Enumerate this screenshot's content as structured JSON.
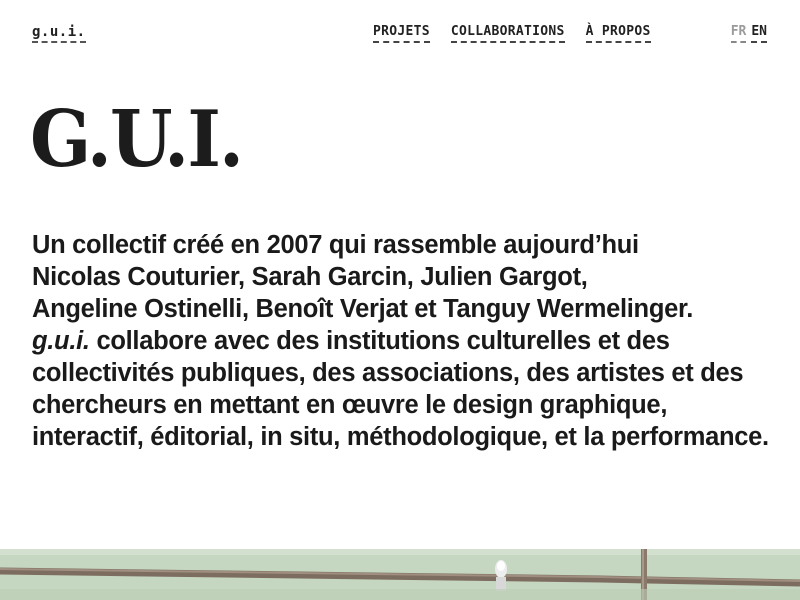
{
  "header": {
    "logo": "g.u.i.",
    "nav": [
      {
        "label": "PROJETS"
      },
      {
        "label": "COLLABORATIONS"
      },
      {
        "label": "À PROPOS"
      }
    ],
    "lang": {
      "fr": "FR",
      "en": "EN",
      "active": "EN"
    }
  },
  "main": {
    "title": "G.U.I.",
    "intro": {
      "line1": "Un collectif créé en 2007 qui rassemble aujourd’hui",
      "line2": "Nicolas Couturier, Sarah Garcin, Julien Gargot,",
      "line3": "Angeline Ostinelli, Benoît Verjat et Tanguy Wermelinger.",
      "brand": "g.u.i.",
      "rest": " collabore avec des institutions culturelles et des collectivités publiques, des associations, des artistes et des chercheurs en mettant en œuvre le design graphique, interactif, éditorial, in situ, méthodologique, et la performance."
    }
  },
  "photo": {
    "wall_color": "#c6d7c1",
    "pipe_color": "#8a7a6c"
  }
}
